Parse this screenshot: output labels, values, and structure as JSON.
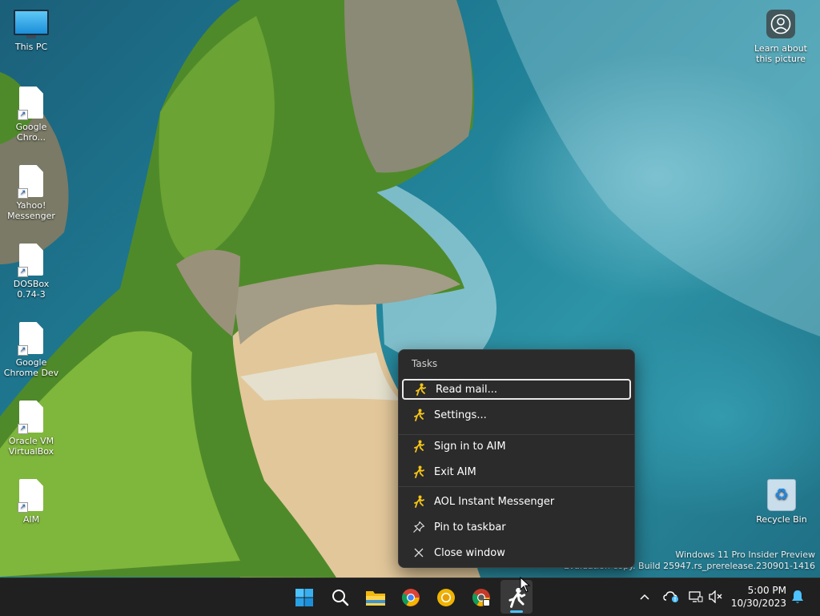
{
  "desktop": {
    "icons": [
      {
        "label": "This PC",
        "kind": "pc-icon"
      },
      {
        "label": "Google Chro...",
        "kind": "shortcut-icon"
      },
      {
        "label": "Yahoo! Messenger",
        "kind": "shortcut-icon"
      },
      {
        "label": "DOSBox 0.74-3",
        "kind": "shortcut-icon"
      },
      {
        "label": "Google Chrome Dev",
        "kind": "shortcut-icon"
      },
      {
        "label": "Oracle VM VirtualBox",
        "kind": "shortcut-icon"
      },
      {
        "label": "AIM",
        "kind": "shortcut-icon"
      }
    ],
    "learn": {
      "label": "Learn about this picture"
    },
    "recycle_bin": {
      "label": "Recycle Bin"
    },
    "watermark": {
      "line1": "Windows 11 Pro Insider Preview",
      "line2": "Evaluation copy. Build 25947.rs_prerelease.230901-1416"
    }
  },
  "jumplist": {
    "header": "Tasks",
    "items": [
      {
        "label": "Read mail...",
        "icon": "aim-running-man-icon"
      },
      {
        "label": "Settings...",
        "icon": "aim-running-man-icon"
      },
      {
        "label": "Sign in to AIM",
        "icon": "aim-running-man-icon"
      },
      {
        "label": "Exit AIM",
        "icon": "aim-running-man-icon"
      },
      {
        "label": "AOL Instant Messenger",
        "icon": "aim-running-man-icon"
      },
      {
        "label": "Pin to taskbar",
        "icon": "pin-icon"
      },
      {
        "label": "Close window",
        "icon": "close-icon"
      }
    ]
  },
  "taskbar": {
    "time": "5:00 PM",
    "date": "10/30/2023"
  },
  "colors": {
    "aim_yellow": "#f5c518",
    "accent": "#4cc2ff",
    "taskbar_bg": "#202020",
    "menu_bg": "#2b2b2b"
  }
}
